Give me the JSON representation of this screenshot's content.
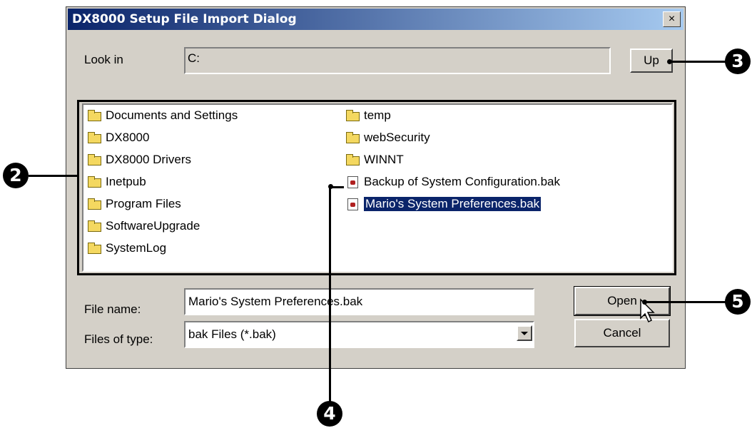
{
  "dialog": {
    "title": "DX8000 Setup File Import Dialog",
    "close_label": "×"
  },
  "look_in": {
    "label": "Look in",
    "value": "C:",
    "up_label": "Up"
  },
  "file_list": {
    "column1": [
      {
        "name": "Documents and Settings",
        "type": "folder"
      },
      {
        "name": "DX8000",
        "type": "folder"
      },
      {
        "name": "DX8000 Drivers",
        "type": "folder"
      },
      {
        "name": "Inetpub",
        "type": "folder"
      },
      {
        "name": "Program Files",
        "type": "folder"
      },
      {
        "name": "SoftwareUpgrade",
        "type": "folder"
      },
      {
        "name": "SystemLog",
        "type": "folder"
      }
    ],
    "column2": [
      {
        "name": "temp",
        "type": "folder"
      },
      {
        "name": "webSecurity",
        "type": "folder"
      },
      {
        "name": "WINNT",
        "type": "folder"
      },
      {
        "name": "Backup of System Configuration.bak",
        "type": "bak-file"
      },
      {
        "name": "Mario's System Preferences.bak",
        "type": "bak-file",
        "selected": true
      }
    ]
  },
  "file_name": {
    "label": "File name:",
    "value": "Mario's System Preferences.bak"
  },
  "files_of_type": {
    "label": "Files of type:",
    "value": "bak Files (*.bak)"
  },
  "buttons": {
    "open": "Open",
    "cancel": "Cancel"
  },
  "callouts": [
    "2",
    "3",
    "4",
    "5"
  ]
}
